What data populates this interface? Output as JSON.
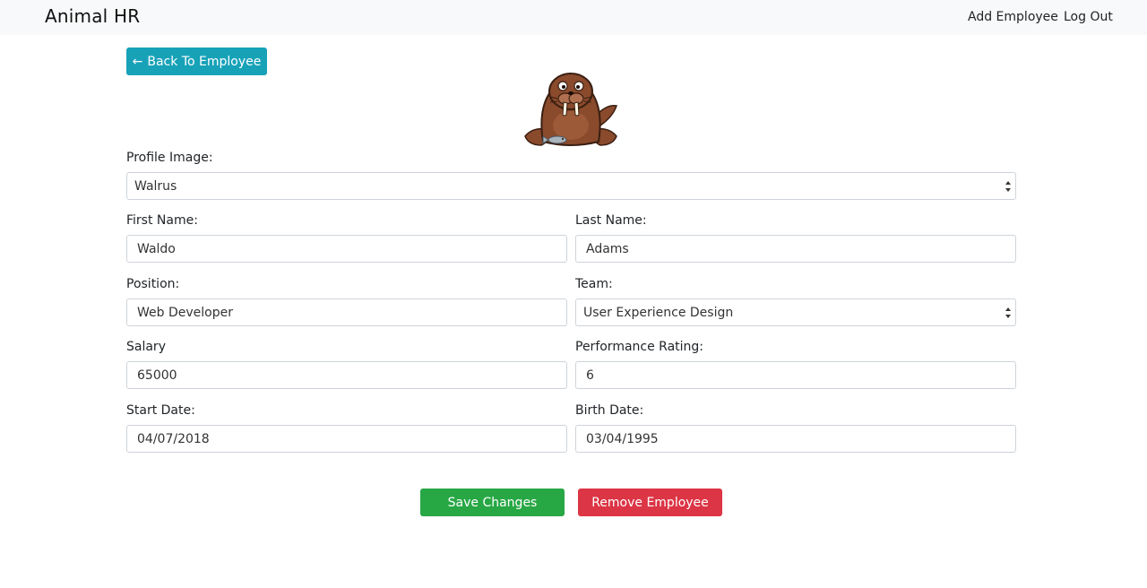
{
  "navbar": {
    "brand": "Animal HR",
    "links": [
      "Add Employee",
      "Log Out"
    ]
  },
  "back_button": {
    "arrow": "←",
    "label": "Back To Employee"
  },
  "avatar_icon": "walrus-icon",
  "form": {
    "profile_image": {
      "label": "Profile Image:",
      "value": "Walrus"
    },
    "first_name": {
      "label": "First Name:",
      "value": "Waldo"
    },
    "last_name": {
      "label": "Last Name:",
      "value": "Adams"
    },
    "position": {
      "label": "Position:",
      "value": "Web Developer"
    },
    "team": {
      "label": "Team:",
      "value": "User Experience Design"
    },
    "salary": {
      "label": "Salary",
      "value": "65000"
    },
    "performance_rating": {
      "label": "Performance Rating:",
      "value": "6"
    },
    "start_date": {
      "label": "Start Date:",
      "value": "04/07/2018"
    },
    "birth_date": {
      "label": "Birth Date:",
      "value": "03/04/1995"
    }
  },
  "actions": {
    "save_label": "Save Changes",
    "remove_label": "Remove Employee"
  },
  "colors": {
    "info": "#17a2b8",
    "success": "#28a745",
    "danger": "#dc3545",
    "navbar_bg": "#f8f9fa"
  }
}
